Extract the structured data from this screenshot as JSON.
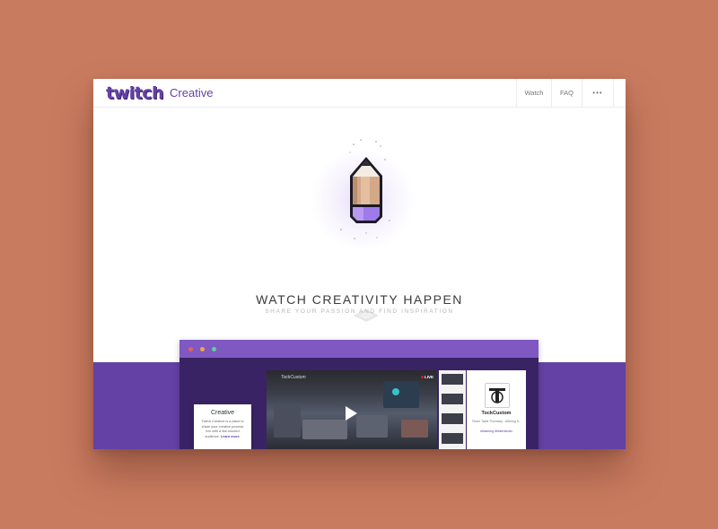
{
  "header": {
    "logo_text": "twitch",
    "product_name": "Creative",
    "nav": [
      "Watch",
      "FAQ"
    ],
    "more_icon": "ellipsis-icon",
    "brand_color": "#6441a5"
  },
  "hero": {
    "icon": "pencil-icon",
    "headline": "WATCH CREATIVITY HAPPEN",
    "subheadline": "SHARE YOUR PASSION AND FIND INSPIRATION"
  },
  "preview": {
    "window_dots": [
      "#e55f5f",
      "#e8a94a",
      "#5ecf9b"
    ],
    "player": {
      "channel_label": "TockCustom",
      "live_label": "LIVE",
      "play_icon": "play-icon"
    },
    "profile": {
      "name": "TockCustom",
      "subtitle": "Tinker Table Thursday - Altering fi...",
      "tags": "#tinkering  #tinkerstudio"
    },
    "card": {
      "title": "Creative",
      "text": "Twitch Creative is a place to share your creative process live with a like-minded audience.",
      "link": "Learn more."
    }
  }
}
